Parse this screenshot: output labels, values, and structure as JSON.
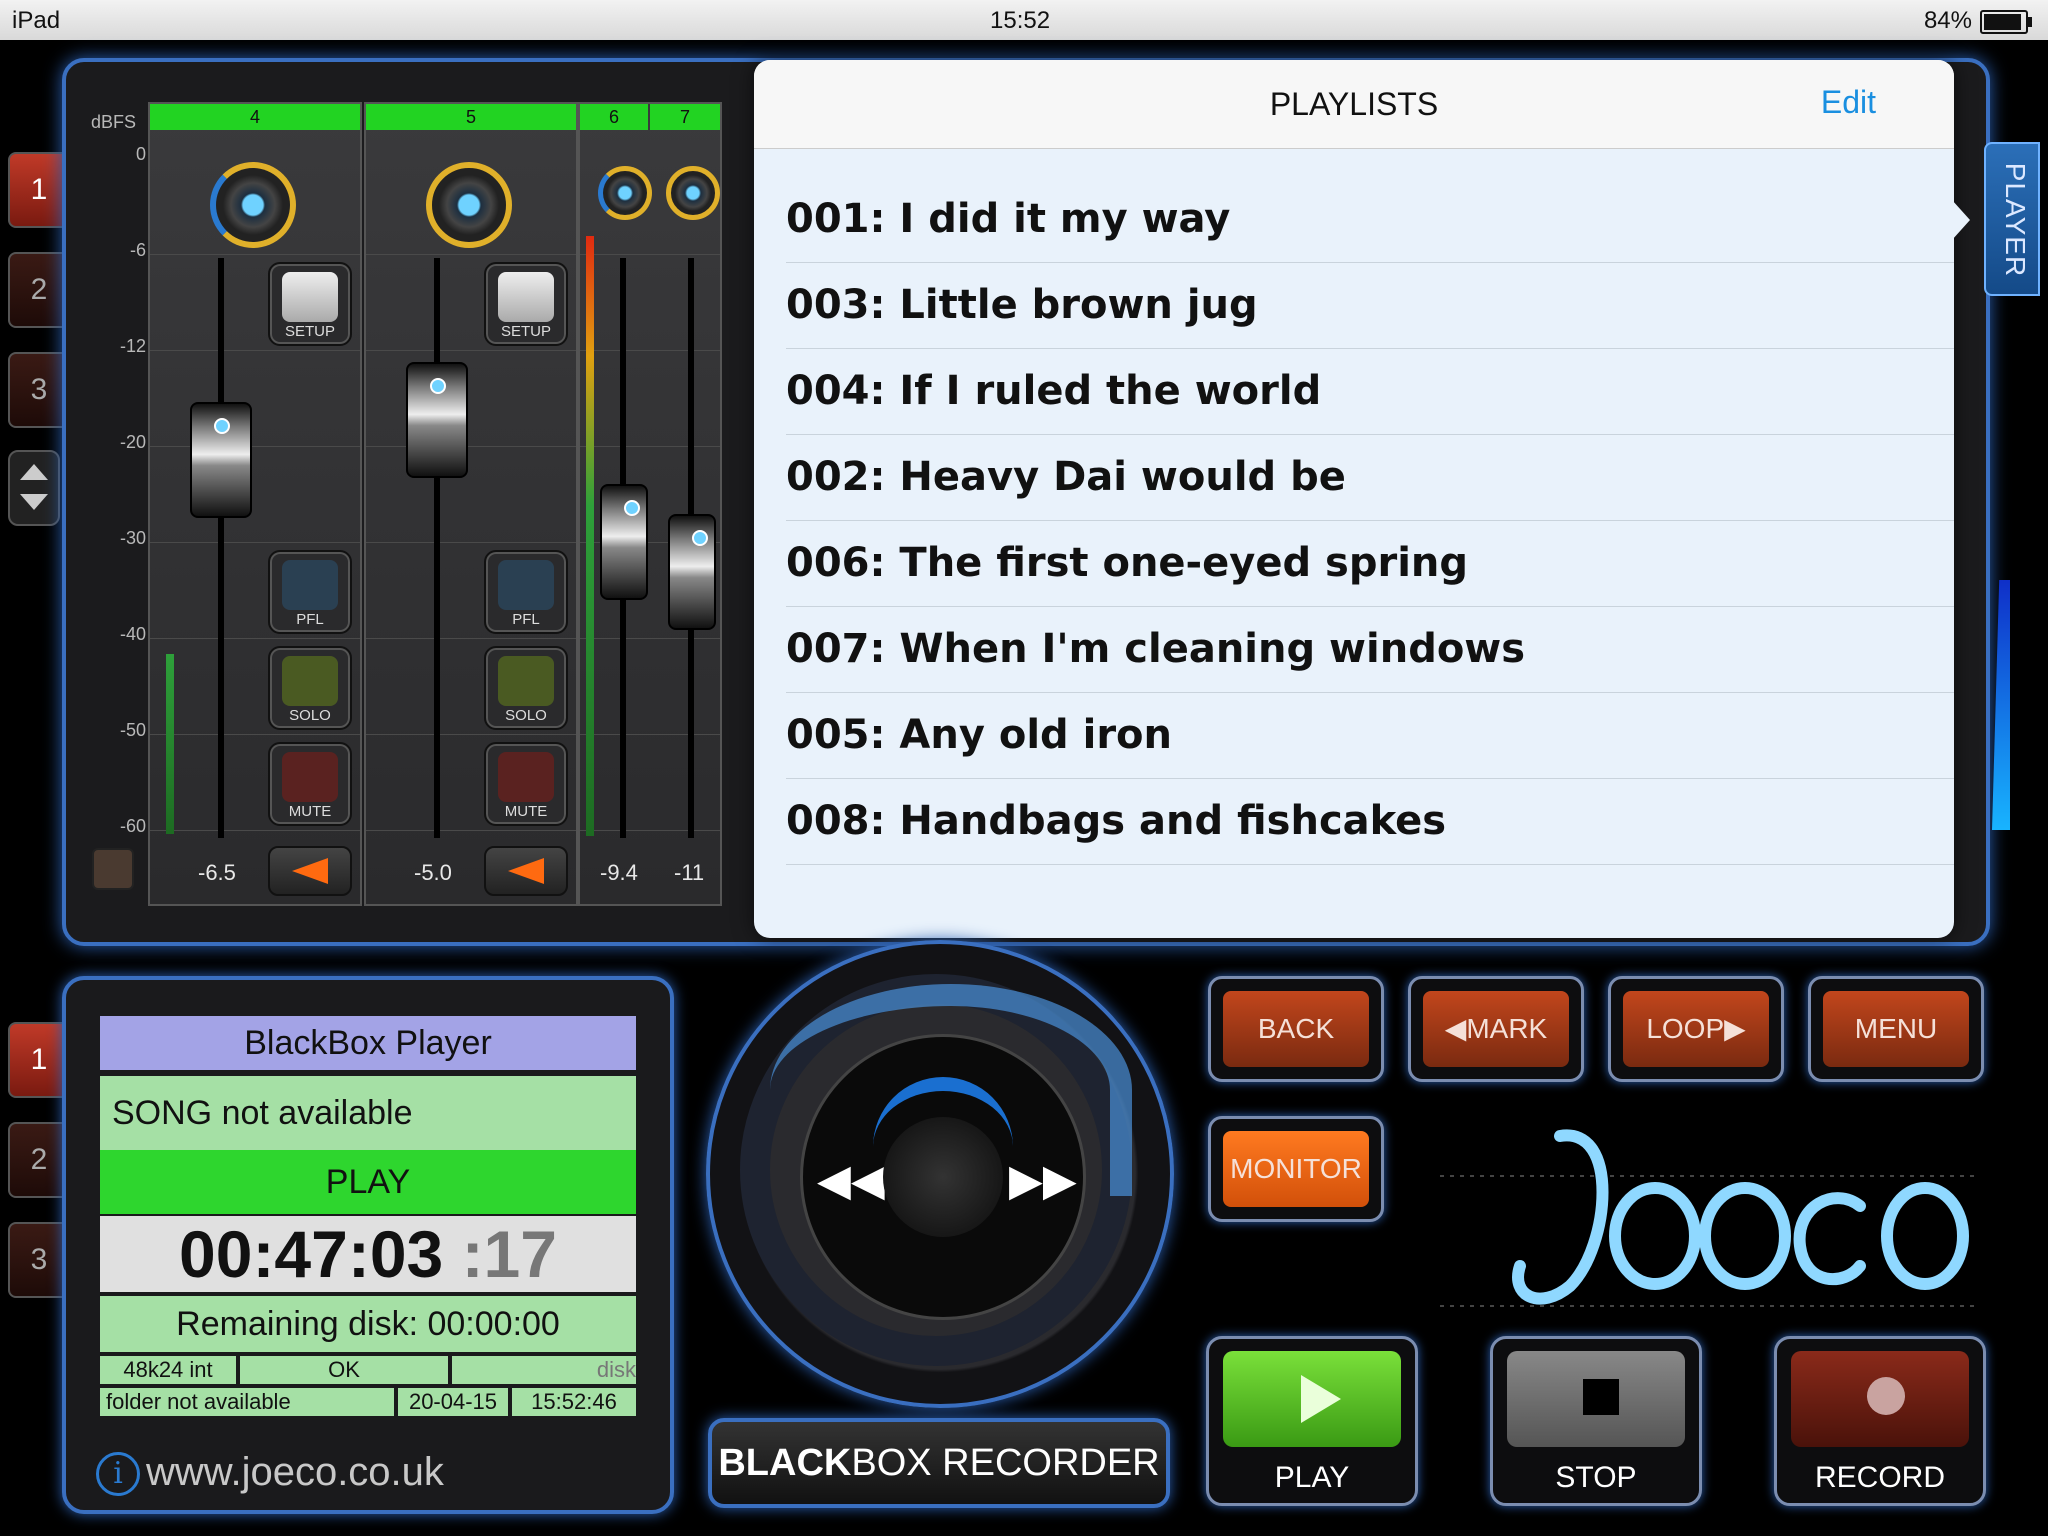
{
  "status_bar": {
    "device": "iPad",
    "time": "15:52",
    "battery": "84%"
  },
  "mixer": {
    "scale_title": "dBFS",
    "scale": [
      "0",
      "-6",
      "-12",
      "-20",
      "-30",
      "-40",
      "-50",
      "-60"
    ],
    "channels": [
      {
        "num": "4",
        "value": "-6.5",
        "setup": "SETUP",
        "pfl": "PFL",
        "solo": "SOLO",
        "mute": "MUTE"
      },
      {
        "num": "5",
        "value": "-5.0",
        "setup": "SETUP",
        "pfl": "PFL",
        "solo": "SOLO",
        "mute": "MUTE"
      },
      {
        "num": "6",
        "value": "-9.4"
      },
      {
        "num": "7",
        "value": "-11"
      }
    ]
  },
  "banks_top": [
    "1",
    "2",
    "3"
  ],
  "banks_bottom": [
    "1",
    "2",
    "3"
  ],
  "playlists": {
    "title": "PLAYLISTS",
    "edit": "Edit",
    "items": [
      "001: I did it my way",
      "003: Little brown jug",
      "004: If I ruled the world",
      "002: Heavy Dai would be",
      "006: The first one-eyed spring",
      "007: When I'm cleaning windows",
      "005: Any old iron",
      "008: Handbags and fishcakes"
    ]
  },
  "player_tab": "PLAYER",
  "status_panel": {
    "title": "BlackBox Player",
    "song": "SONG not available",
    "state": "PLAY",
    "time": "00:47:03",
    "frames": ":17",
    "remaining": "Remaining disk: 00:00:00",
    "format": "48k24 int",
    "ok": "OK",
    "disk": "disk",
    "folder": "folder not available",
    "date": "20-04-15",
    "clock": "15:52:46",
    "website": "www.joeco.co.uk"
  },
  "jog": {
    "rewind": "◀◀",
    "forward": "▶▶"
  },
  "product": {
    "bold": "BLACK",
    "rest": "BOX RECORDER"
  },
  "buttons": {
    "back": "BACK",
    "mark": "◀MARK",
    "loop": "LOOP▶",
    "menu": "MENU",
    "monitor": "MONITOR"
  },
  "transport": {
    "play": "PLAY",
    "stop": "STOP",
    "record": "RECORD"
  },
  "colors": {
    "accent_blue": "#3a6fc0",
    "meter_green": "#22d322",
    "play_green": "#2ed62e",
    "record_red": "#8a2a1a"
  }
}
